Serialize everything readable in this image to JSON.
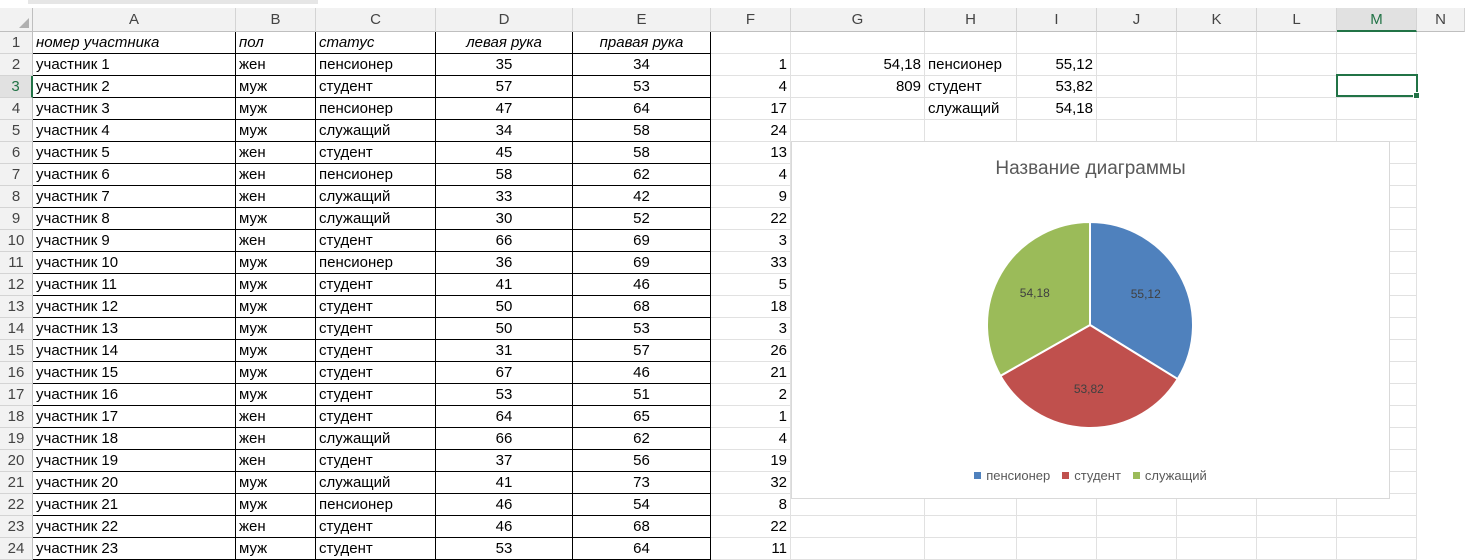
{
  "columns": [
    "A",
    "B",
    "C",
    "D",
    "E",
    "F",
    "G",
    "H",
    "I",
    "J",
    "K",
    "L",
    "M",
    "N"
  ],
  "selected_column": "M",
  "selected_row": "3",
  "rows": [
    {
      "n": "1",
      "a": "номер участника",
      "b": "пол",
      "c": "статус",
      "d": "левая рука",
      "e": "правая рука",
      "f": "",
      "g": "",
      "h": "",
      "i": ""
    },
    {
      "n": "2",
      "a": "участник 1",
      "b": "жен",
      "c": "пенсионер",
      "d": "35",
      "e": "34",
      "f": "1",
      "g": "54,18",
      "h": "пенсионер",
      "i": "55,12"
    },
    {
      "n": "3",
      "a": "участник 2",
      "b": "муж",
      "c": "студент",
      "d": "57",
      "e": "53",
      "f": "4",
      "g": "809",
      "h": "студент",
      "i": "53,82"
    },
    {
      "n": "4",
      "a": "участник 3",
      "b": "муж",
      "c": "пенсионер",
      "d": "47",
      "e": "64",
      "f": "17",
      "g": "",
      "h": "служащий",
      "i": "54,18"
    },
    {
      "n": "5",
      "a": "участник 4",
      "b": "муж",
      "c": "служащий",
      "d": "34",
      "e": "58",
      "f": "24",
      "g": "",
      "h": "",
      "i": ""
    },
    {
      "n": "6",
      "a": "участник 5",
      "b": "жен",
      "c": "студент",
      "d": "45",
      "e": "58",
      "f": "13",
      "g": "",
      "h": "",
      "i": ""
    },
    {
      "n": "7",
      "a": "участник 6",
      "b": "жен",
      "c": "пенсионер",
      "d": "58",
      "e": "62",
      "f": "4",
      "g": "",
      "h": "",
      "i": ""
    },
    {
      "n": "8",
      "a": "участник 7",
      "b": "жен",
      "c": "служащий",
      "d": "33",
      "e": "42",
      "f": "9",
      "g": "",
      "h": "",
      "i": ""
    },
    {
      "n": "9",
      "a": "участник 8",
      "b": "муж",
      "c": "служащий",
      "d": "30",
      "e": "52",
      "f": "22",
      "g": "",
      "h": "",
      "i": ""
    },
    {
      "n": "10",
      "a": "участник 9",
      "b": "жен",
      "c": "студент",
      "d": "66",
      "e": "69",
      "f": "3",
      "g": "",
      "h": "",
      "i": ""
    },
    {
      "n": "11",
      "a": "участник 10",
      "b": "муж",
      "c": "пенсионер",
      "d": "36",
      "e": "69",
      "f": "33",
      "g": "",
      "h": "",
      "i": ""
    },
    {
      "n": "12",
      "a": "участник 11",
      "b": "муж",
      "c": "студент",
      "d": "41",
      "e": "46",
      "f": "5",
      "g": "",
      "h": "",
      "i": ""
    },
    {
      "n": "13",
      "a": "участник 12",
      "b": "муж",
      "c": "студент",
      "d": "50",
      "e": "68",
      "f": "18",
      "g": "",
      "h": "",
      "i": ""
    },
    {
      "n": "14",
      "a": "участник 13",
      "b": "муж",
      "c": "студент",
      "d": "50",
      "e": "53",
      "f": "3",
      "g": "",
      "h": "",
      "i": ""
    },
    {
      "n": "15",
      "a": "участник 14",
      "b": "муж",
      "c": "студент",
      "d": "31",
      "e": "57",
      "f": "26",
      "g": "",
      "h": "",
      "i": ""
    },
    {
      "n": "16",
      "a": "участник 15",
      "b": "муж",
      "c": "студент",
      "d": "67",
      "e": "46",
      "f": "21",
      "g": "",
      "h": "",
      "i": ""
    },
    {
      "n": "17",
      "a": "участник 16",
      "b": "муж",
      "c": "студент",
      "d": "53",
      "e": "51",
      "f": "2",
      "g": "",
      "h": "",
      "i": ""
    },
    {
      "n": "18",
      "a": "участник 17",
      "b": "жен",
      "c": "студент",
      "d": "64",
      "e": "65",
      "f": "1",
      "g": "",
      "h": "",
      "i": ""
    },
    {
      "n": "19",
      "a": "участник 18",
      "b": "жен",
      "c": "служащий",
      "d": "66",
      "e": "62",
      "f": "4",
      "g": "",
      "h": "",
      "i": ""
    },
    {
      "n": "20",
      "a": "участник 19",
      "b": "жен",
      "c": "студент",
      "d": "37",
      "e": "56",
      "f": "19",
      "g": "",
      "h": "",
      "i": ""
    },
    {
      "n": "21",
      "a": "участник 20",
      "b": "муж",
      "c": "служащий",
      "d": "41",
      "e": "73",
      "f": "32",
      "g": "",
      "h": "",
      "i": ""
    },
    {
      "n": "22",
      "a": "участник 21",
      "b": "муж",
      "c": "пенсионер",
      "d": "46",
      "e": "54",
      "f": "8",
      "g": "",
      "h": "",
      "i": ""
    },
    {
      "n": "23",
      "a": "участник 22",
      "b": "жен",
      "c": "студент",
      "d": "46",
      "e": "68",
      "f": "22",
      "g": "",
      "h": "",
      "i": ""
    },
    {
      "n": "24",
      "a": "участник 23",
      "b": "муж",
      "c": "студент",
      "d": "53",
      "e": "64",
      "f": "11",
      "g": "",
      "h": "",
      "i": ""
    }
  ],
  "chart_data": {
    "type": "pie",
    "title": "Название диаграммы",
    "categories": [
      "пенсионер",
      "студент",
      "служащий"
    ],
    "values": [
      55.12,
      53.82,
      54.18
    ],
    "value_labels": [
      "55,12",
      "53,82",
      "54,18"
    ],
    "colors": [
      "#4f81bd",
      "#c0504d",
      "#9bbb59"
    ],
    "legend_position": "bottom"
  }
}
